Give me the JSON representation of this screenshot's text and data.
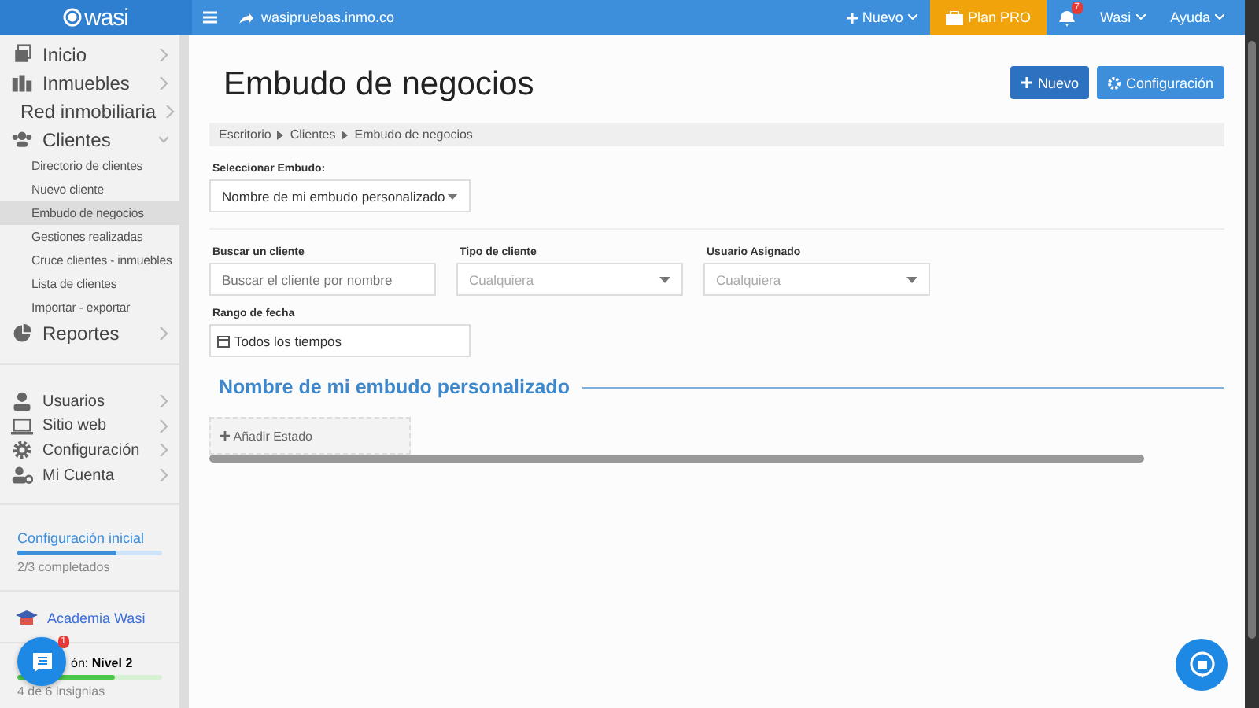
{
  "topbar": {
    "logo": "wasi",
    "site": "wasipruebas.inmo.co",
    "new_menu": "Nuevo",
    "plan": "Plan PRO",
    "notifications": "7",
    "user": "Wasi",
    "help": "Ayuda"
  },
  "sidebar": {
    "items": [
      {
        "label": "Inicio",
        "kind": "home",
        "expanded": false
      },
      {
        "label": "Inmuebles",
        "kind": "buildings",
        "expanded": false
      },
      {
        "label": "Red inmobiliaria",
        "kind": "network",
        "expanded": false
      },
      {
        "label": "Clientes",
        "kind": "people",
        "expanded": true,
        "children": [
          {
            "label": "Directorio de clientes",
            "selected": false
          },
          {
            "label": "Nuevo cliente",
            "selected": false
          },
          {
            "label": "Embudo de negocios",
            "selected": true
          },
          {
            "label": "Gestiones realizadas",
            "selected": false
          },
          {
            "label": "Cruce clientes - inmuebles",
            "selected": false
          },
          {
            "label": "Lista de clientes",
            "selected": false
          },
          {
            "label": "Importar - exportar",
            "selected": false
          }
        ]
      },
      {
        "label": "Reportes",
        "kind": "pie",
        "expanded": false
      }
    ],
    "items2": [
      {
        "label": "Usuarios",
        "kind": "user"
      },
      {
        "label": "Sitio web",
        "kind": "laptop"
      },
      {
        "label": "Configuración",
        "kind": "gear"
      },
      {
        "label": "Mi Cuenta",
        "kind": "account"
      }
    ],
    "setup": {
      "title": "Configuración inicial",
      "level": 0.68,
      "caption": "2/3 completados"
    },
    "academy": "Academia Wasi",
    "level_card": {
      "title": "ón: **Nivel 2**",
      "level": 0.67,
      "caption": "4 de 6 insignias"
    },
    "chat_badge": "1"
  },
  "page": {
    "title": "Embudo de negocios",
    "buttons": [
      {
        "label": "Nuevo",
        "kind": "add"
      },
      {
        "label": "Configuración",
        "kind": "settings"
      }
    ],
    "breadcrumb": [
      "Escritorio",
      "Clientes",
      "Embudo de negocios"
    ],
    "funnel_select": {
      "label": "Seleccionar Embudo:",
      "value": "Nombre de mi embudo personalizado"
    },
    "filters": [
      {
        "label": "Buscar un cliente",
        "kind": "text",
        "placeholder": "Buscar el cliente por nombre"
      },
      {
        "label": "Tipo de cliente",
        "kind": "select",
        "placeholder": "Cualquiera"
      },
      {
        "label": "Usuario Asignado",
        "kind": "select",
        "placeholder": "Cualquiera"
      }
    ],
    "date_range": {
      "label": "Rango de fecha",
      "value": "Todos los tiempos"
    },
    "funnel_title": "Nombre de mi embudo personalizado",
    "add_state": "Añadir Estado"
  }
}
